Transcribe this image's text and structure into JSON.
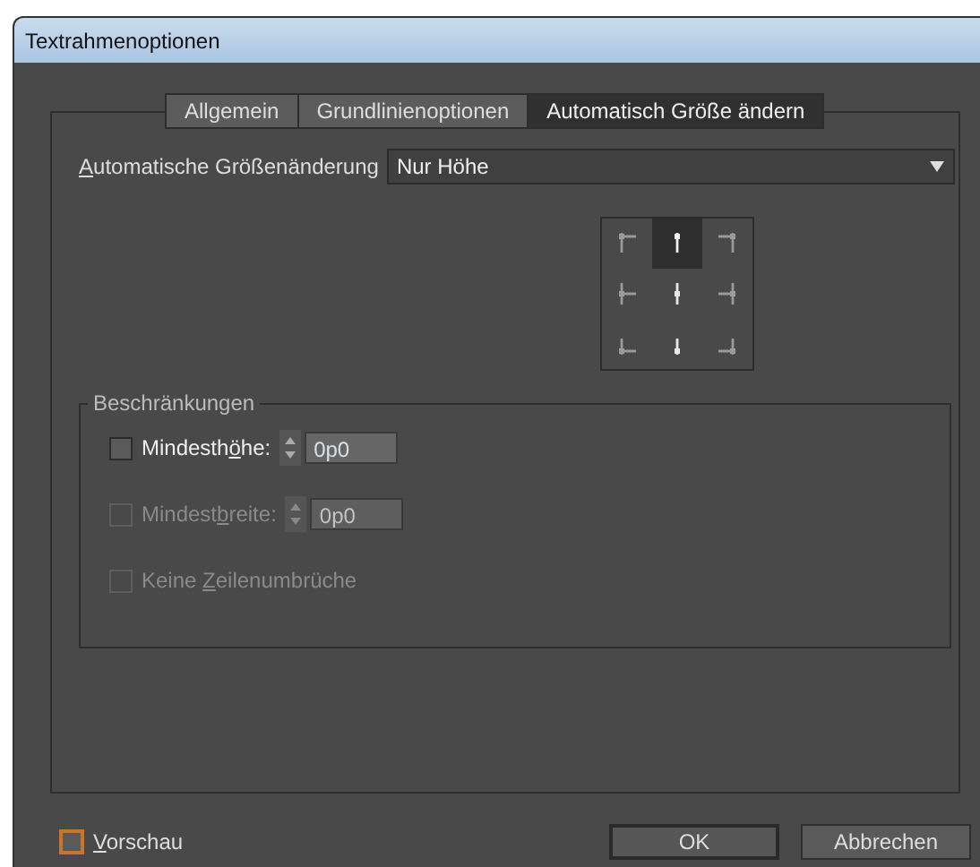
{
  "window": {
    "title": "Textrahmenoptionen"
  },
  "tabs": [
    {
      "label": "Allgemein",
      "selected": false
    },
    {
      "label": "Grundlinienoptionen",
      "selected": false
    },
    {
      "label": "Automatisch Größe ändern",
      "selected": true
    }
  ],
  "auto_size": {
    "label_parts": {
      "key": "A",
      "after": "utomatische Größenänderung"
    },
    "value": "Nur Höhe"
  },
  "anchor_points": [
    {
      "selected": false
    },
    {
      "selected": true
    },
    {
      "selected": false
    },
    {
      "selected": false
    },
    {
      "selected": false
    },
    {
      "selected": false
    },
    {
      "selected": false
    },
    {
      "selected": false
    },
    {
      "selected": false
    }
  ],
  "constraints": {
    "title": "Beschränkungen",
    "items": [
      {
        "kind": "spinner",
        "label_parts": {
          "before": "Mindesth",
          "key": "ö",
          "after": "he:"
        },
        "checked": false,
        "disabled": false,
        "value": "0p0"
      },
      {
        "kind": "spinner",
        "label_parts": {
          "before": "Mindest",
          "key": "b",
          "after": "reite:"
        },
        "checked": false,
        "disabled": true,
        "value": "0p0"
      },
      {
        "kind": "check",
        "label_parts": {
          "before": "Keine ",
          "key": "Z",
          "after": "eilenumbrüche"
        },
        "checked": false,
        "disabled": true
      }
    ]
  },
  "preview": {
    "label_parts": {
      "key": "V",
      "after": "orschau"
    },
    "checked": false,
    "focused": true
  },
  "buttons": [
    {
      "label": "OK",
      "default": true
    },
    {
      "label": "Abbrechen",
      "default": false
    }
  ]
}
